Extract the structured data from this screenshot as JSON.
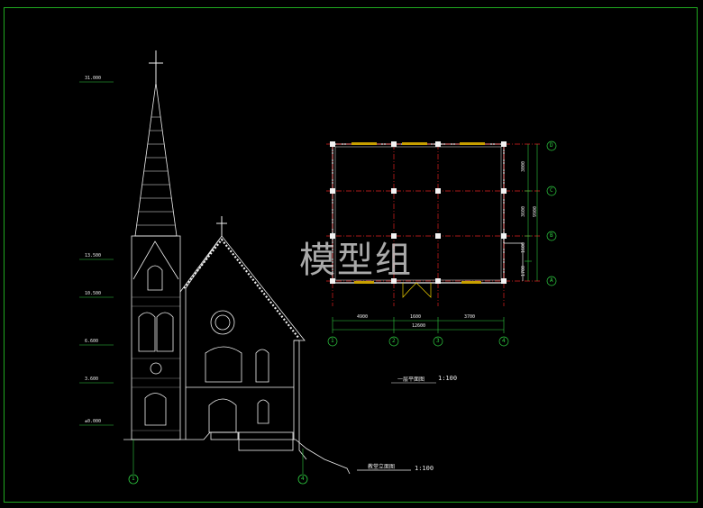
{
  "watermark": "模型组",
  "elevation": {
    "title": "教堂立面图",
    "scale": "1:100",
    "level_marks": [
      "31.000",
      "13.500",
      "10.500",
      "6.600",
      "3.600",
      "±0.000"
    ],
    "axis_labels": [
      "1",
      "4"
    ]
  },
  "plan": {
    "title": "一层平面图",
    "scale": "1:100",
    "column_axes": [
      "1",
      "2",
      "3",
      "4"
    ],
    "row_axes": [
      "D",
      "C",
      "B",
      "A"
    ],
    "bottom_dims": [
      "4900",
      "1600",
      "3700"
    ],
    "total_dim": "12600",
    "right_dims": [
      "3000",
      "3600",
      "1600",
      "1700"
    ],
    "right_total": "9900"
  },
  "colors": {
    "background": "#000000",
    "frame": "#1fa81f",
    "axis_red": "#e02020",
    "lines": "#f2f2f2",
    "grid_bubble": "#2ecc40",
    "window_fill": "#c8a000"
  }
}
